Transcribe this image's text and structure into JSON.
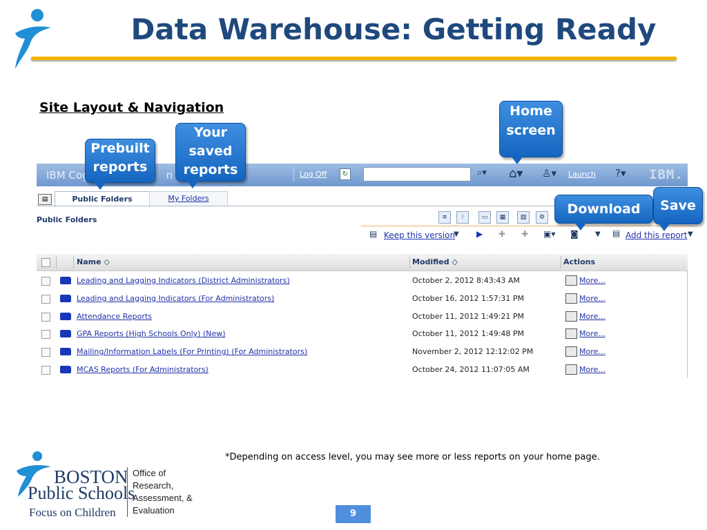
{
  "slide": {
    "title": "Data Warehouse: Getting Ready",
    "subtitle": "Site Layout & Navigation",
    "note": "*Depending on access level, you may see more or less reports on your home page.",
    "page_number": "9"
  },
  "app_bar": {
    "app_name": "IBM Cog",
    "app_name_tail": "n",
    "log_off": "Log Off",
    "launch": "Launch",
    "ibm_logo": "IBM."
  },
  "tabs": [
    {
      "label": "Public Folders",
      "active": true
    },
    {
      "label": "My Folders",
      "active": false
    }
  ],
  "folder_title": "Public Folders",
  "toolbar": {
    "keep_version": "Keep this version",
    "add_report": "Add this report"
  },
  "list": {
    "columns": [
      "Name",
      "Modified",
      "Actions"
    ],
    "rows": [
      {
        "name": "Leading and Lagging Indicators (District Administrators)",
        "modified": "October 2, 2012 8:43:43 AM",
        "action": "More..."
      },
      {
        "name": "Leading and Lagging Indicators (For Administrators)",
        "modified": "October 16, 2012 1:57:31 PM",
        "action": "More..."
      },
      {
        "name": "Attendance Reports",
        "modified": "October 11, 2012 1:49:21 PM",
        "action": "More..."
      },
      {
        "name": "GPA Reports (High Schools Only) (New)",
        "modified": "October 11, 2012 1:49:48 PM",
        "action": "More..."
      },
      {
        "name": "Mailing/Information Labels (For Printing) (For Administrators)",
        "modified": "November 2, 2012 12:12:02 PM",
        "action": "More..."
      },
      {
        "name": "MCAS Reports (For Administrators)",
        "modified": "October 24, 2012 11:07:05 AM",
        "action": "More..."
      }
    ]
  },
  "callouts": {
    "prebuilt": "Prebuilt reports",
    "saved": "Your saved reports",
    "home": "Home screen",
    "download": "Download",
    "save": "Save"
  },
  "footer": {
    "boston": "BOSTON",
    "public_schools": "Public Schools",
    "focus": "Focus on Children",
    "office_lines": [
      "Office of",
      "Research,",
      "Assessment, &",
      "Evaluation"
    ]
  },
  "icons": [
    "runner-logo-icon",
    "refresh-icon",
    "search-go-icon",
    "home-icon",
    "user-icon",
    "help-icon",
    "folder-icon",
    "checkbox-icon",
    "more-actions-icon",
    "sort-icon"
  ],
  "colors": {
    "title": "#1f497d",
    "rule": "#f2b705",
    "callout": "#1565c0",
    "link": "#2031a8"
  }
}
